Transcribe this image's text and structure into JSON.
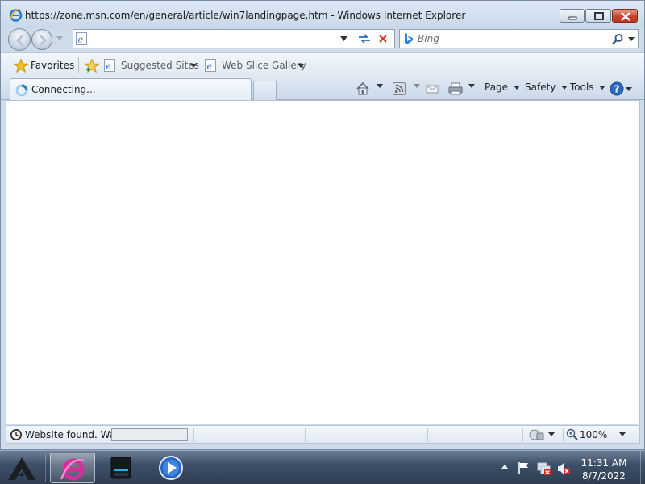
{
  "window": {
    "title": "https://zone.msn.com/en/general/article/win7landingpage.htm - Windows Internet Explorer"
  },
  "address_bar": {
    "value": ""
  },
  "search": {
    "placeholder": "Bing"
  },
  "favorites_bar": {
    "favorites_label": "Favorites",
    "links": [
      {
        "label": "Suggested Sites"
      },
      {
        "label": "Web Slice Gallery"
      }
    ]
  },
  "tab": {
    "label": "Connecting..."
  },
  "command_bar": {
    "page_label": "Page",
    "safety_label": "Safety",
    "tools_label": "Tools"
  },
  "status_bar": {
    "text": "Website found. Wai",
    "progress_fraction": 0.0,
    "zoom_label": "100%"
  },
  "taskbar": {
    "time": "11:31 AM",
    "date": "8/7/2022"
  },
  "colors": {
    "frame": "#cfdbe9",
    "taskbar": "#3e5068",
    "close_button": "#c6452c"
  }
}
